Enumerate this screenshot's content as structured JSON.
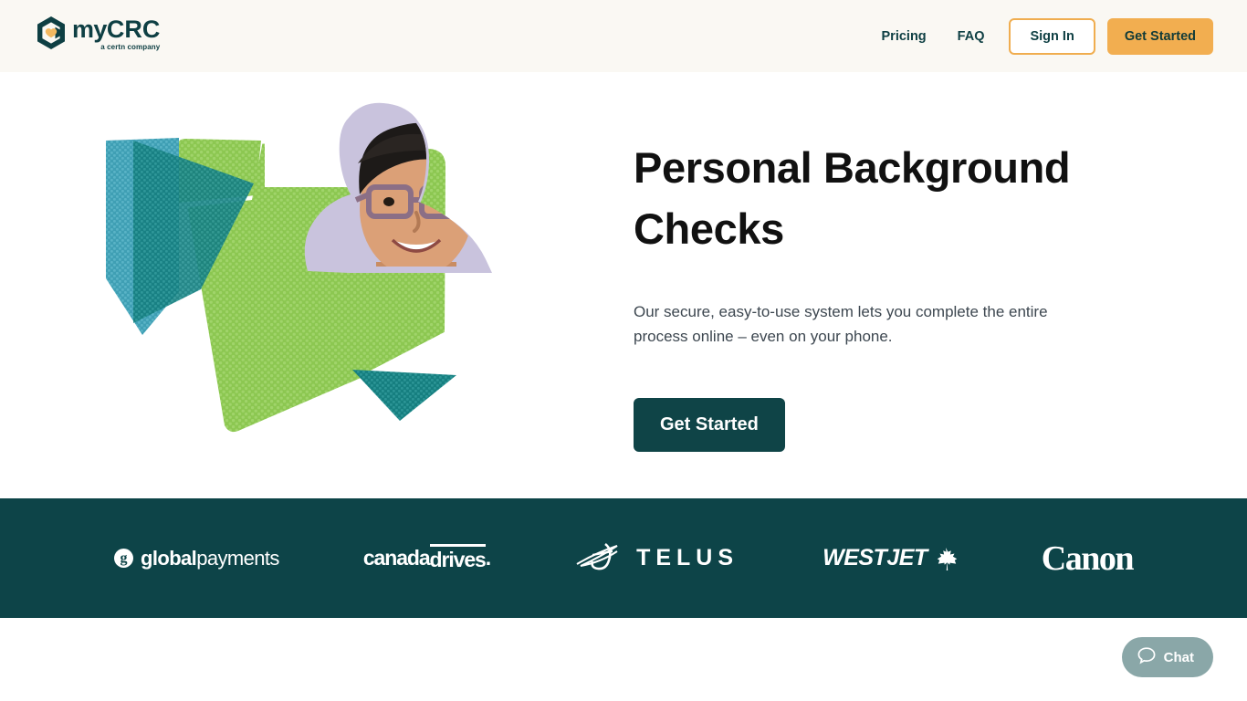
{
  "header": {
    "logo": {
      "name": "myCRC",
      "name_my": "my",
      "name_crc": "CRC",
      "tagline": "a certn company"
    },
    "nav": [
      {
        "label": "Pricing"
      },
      {
        "label": "FAQ"
      }
    ],
    "sign_in_label": "Sign In",
    "get_started_label": "Get Started",
    "background": "#faf8f3",
    "accent": "#f2ae50"
  },
  "hero": {
    "title": "Personal Background Checks",
    "subtitle": "Our secure, easy-to-use system lets you complete the entire process online – even on your phone.",
    "cta_label": "Get Started",
    "cta_color": "#0f4447",
    "image_alt": "Smiling man with glasses in red plaid shirt on green geometric background"
  },
  "logo_band": {
    "background": "#0d4448",
    "brands": [
      {
        "name": "globalpayments",
        "part1": "global",
        "part2": "payments",
        "mark": "g"
      },
      {
        "name": "canadadrives",
        "part1": "canada",
        "part2": "drives",
        "suffix": "."
      },
      {
        "name": "TELUS",
        "word": "TELUS"
      },
      {
        "name": "WESTJET",
        "word": "WESTJET"
      },
      {
        "name": "Canon",
        "word": "Canon"
      }
    ]
  },
  "chat": {
    "label": "Chat",
    "background": "#8aa7a8"
  }
}
